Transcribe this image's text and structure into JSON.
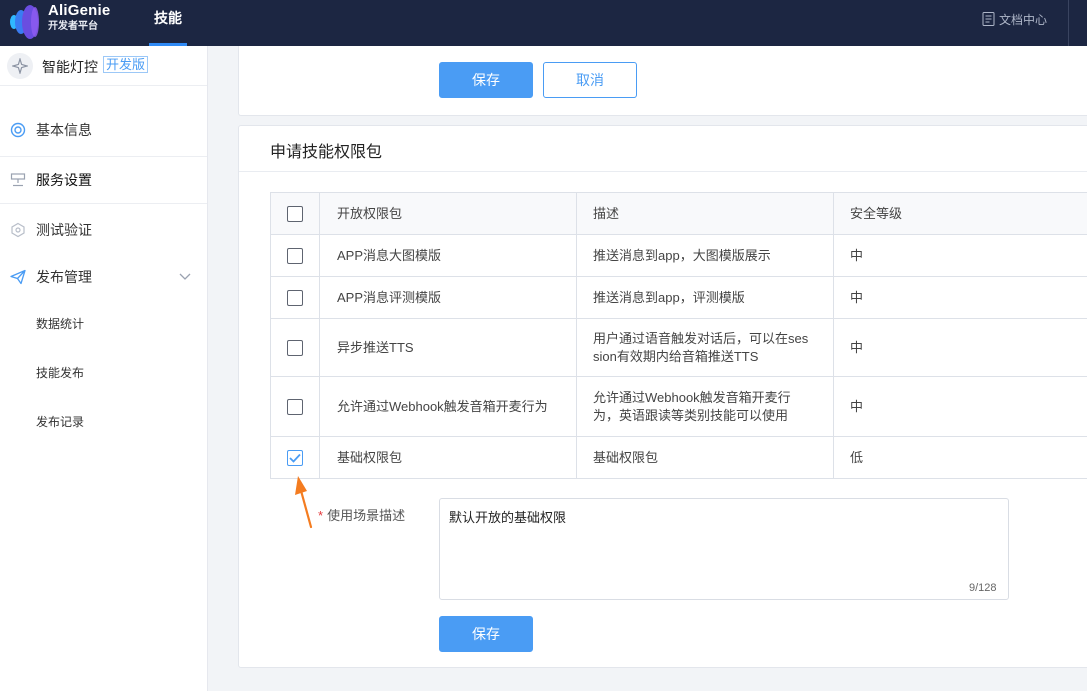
{
  "topbar": {
    "brand_title": "AliGenie",
    "brand_sub": "开发者平台",
    "nav_tab": "技能",
    "doc_link": "文档中心"
  },
  "sidebar": {
    "skill_name": "智能灯控",
    "skill_badge": "开发版",
    "menu": [
      {
        "label": "基本信息",
        "icon": "lifebuoy-icon"
      },
      {
        "label": "服务设置",
        "icon": "server-icon"
      },
      {
        "label": "测试验证",
        "icon": "hexagon-icon"
      },
      {
        "label": "发布管理",
        "icon": "paper-plane-icon"
      }
    ],
    "submenu": [
      "数据统计",
      "技能发布",
      "发布记录"
    ]
  },
  "top_panel": {
    "save_label": "保存",
    "cancel_label": "取消"
  },
  "permissions_panel": {
    "title": "申请技能权限包",
    "columns": [
      "开放权限包",
      "描述",
      "安全等级"
    ],
    "rows": [
      {
        "name": "APP消息大图模版",
        "desc": "推送消息到app，大图模版展示",
        "level": "中",
        "checked": false
      },
      {
        "name": "APP消息评测模版",
        "desc": "推送消息到app，评测模版",
        "level": "中",
        "checked": false
      },
      {
        "name": "异步推送TTS",
        "desc": "用户通过语音触发对话后，可以在session有效期内给音箱推送TTS",
        "level": "中",
        "checked": false
      },
      {
        "name": "允许通过Webhook触发音箱开麦行为",
        "desc": "允许通过Webhook触发音箱开麦行为，英语跟读等类别技能可以使用",
        "level": "中",
        "checked": false
      },
      {
        "name": "基础权限包",
        "desc": "基础权限包",
        "level": "低",
        "checked": true
      }
    ],
    "field_label": "使用场景描述",
    "field_required_mark": "*",
    "field_value": "默认开放的基础权限",
    "field_counter": "9/128",
    "save_label": "保存"
  },
  "colors": {
    "topbar_bg": "#1c2642",
    "accent": "#4a9cf4",
    "annotation_arrow": "#f47c20"
  }
}
